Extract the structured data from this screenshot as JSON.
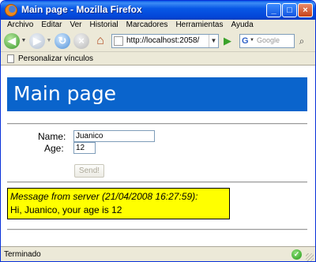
{
  "window": {
    "title": "Main page - Mozilla Firefox"
  },
  "menu": {
    "items": [
      "Archivo",
      "Editar",
      "Ver",
      "Historial",
      "Marcadores",
      "Herramientas",
      "Ayuda"
    ]
  },
  "navigation": {
    "url": "http://localhost:2058/",
    "search_placeholder": "Google"
  },
  "bookmarks": {
    "label": "Personalizar vínculos"
  },
  "page": {
    "title": "Main page",
    "form": {
      "name_label": "Name:",
      "name_value": "Juanico",
      "age_label": "Age:",
      "age_value": "12",
      "send_label": "Send!"
    },
    "message": {
      "header": "Message from server (21/04/2008 16:27:59):",
      "body": "Hi, Juanico, your age is 12"
    }
  },
  "status": {
    "text": "Terminado"
  }
}
